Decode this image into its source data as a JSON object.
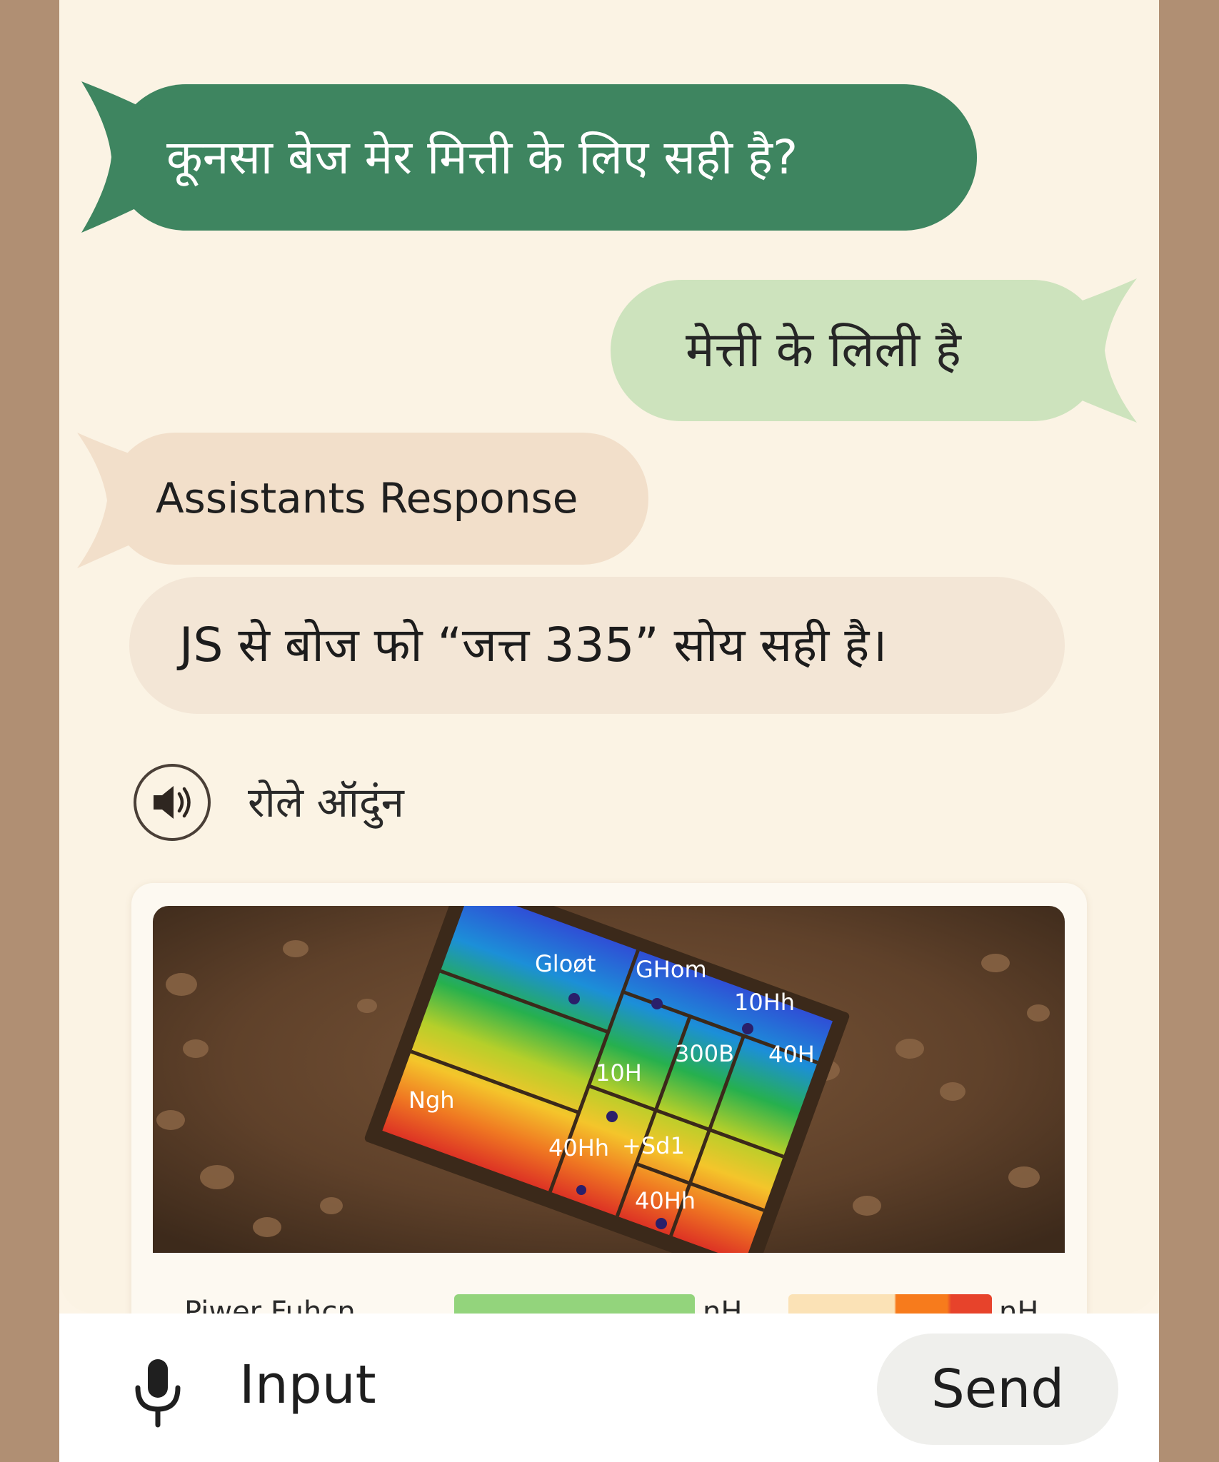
{
  "messages": [
    {
      "id": "user-question",
      "text": "कूनसा बेज मेर मित्ती के लिए सही है?"
    },
    {
      "id": "short-reply",
      "text": "मेत्ती के लिली  है"
    },
    {
      "id": "assistant-header",
      "text": "Assistants Response"
    },
    {
      "id": "assistant-answer",
      "text": "JS से बोज फो “जत्त 335” सोय सही है।"
    }
  ],
  "audio": {
    "label": "रोले ऑदुंन",
    "icon": "speaker-icon"
  },
  "card": {
    "map_labels": [
      "Gloøt",
      "GHom",
      "10Hh",
      "300B",
      "40H",
      "10H",
      "Ngh",
      "40Hh",
      "+Sd1",
      "40Hh"
    ],
    "legend": {
      "label": "Piwer Fuhcn",
      "unit_1": "nH",
      "unit_2": "nH",
      "colors": [
        "#93d47c",
        "#fbe2b6",
        "#f77b1c",
        "#e7432b"
      ]
    }
  },
  "input_bar": {
    "mic_icon": "microphone-icon",
    "placeholder": "Input",
    "send_label": "Send"
  },
  "colors": {
    "user_bubble": "#3e8560",
    "reply_bubble": "#cde3bd",
    "assistant_bubble": "#f2dfca",
    "background": "#fbf3e4"
  }
}
